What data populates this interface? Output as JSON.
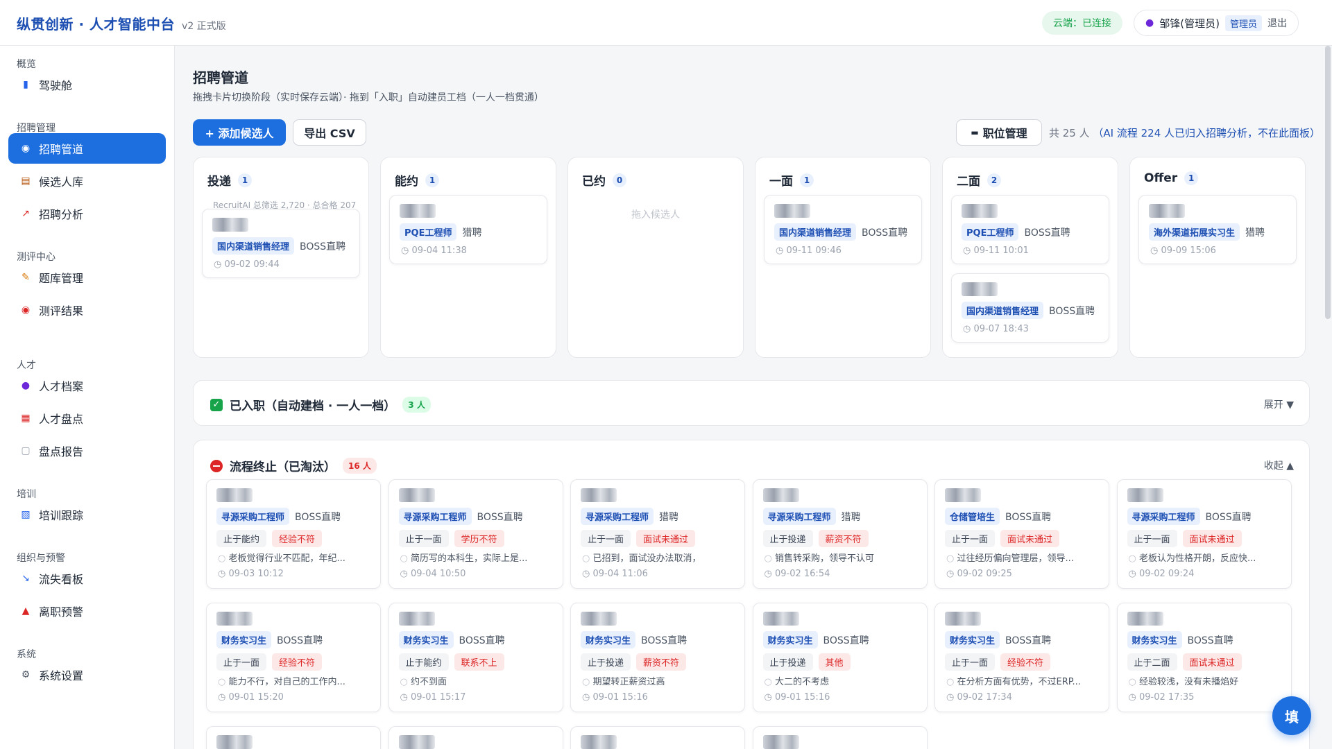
{
  "brand": {
    "title": "纵贯创新 · 人才智能中台",
    "version": "v2 正式版"
  },
  "header": {
    "cloud_status": "云端：已连接",
    "user_name": "邹锋(管理员)",
    "role": "管理员",
    "logout": "退出"
  },
  "sidebar": {
    "sections": [
      {
        "label": "概览",
        "items": [
          {
            "label": "驾驶舱",
            "icon": "dashboard-icon"
          }
        ]
      },
      {
        "label": "招聘管理",
        "items": [
          {
            "label": "招聘管道",
            "icon": "target-icon",
            "active": true
          },
          {
            "label": "候选人库",
            "icon": "clipboard-icon"
          },
          {
            "label": "招聘分析",
            "icon": "trend-chart-icon"
          }
        ]
      },
      {
        "label": "测评中心",
        "items": [
          {
            "label": "题库管理",
            "icon": "edit-doc-icon"
          },
          {
            "label": "测评结果",
            "icon": "target-icon"
          }
        ]
      },
      {
        "label": "人才",
        "items": [
          {
            "label": "人才档案",
            "icon": "person-icon"
          },
          {
            "label": "人才盘点",
            "icon": "calendar-board-icon"
          },
          {
            "label": "盘点报告",
            "icon": "document-icon"
          }
        ]
      },
      {
        "label": "培训",
        "items": [
          {
            "label": "培训跟踪",
            "icon": "books-icon"
          }
        ]
      },
      {
        "label": "组织与预警",
        "items": [
          {
            "label": "流失看板",
            "icon": "down-chart-icon"
          },
          {
            "label": "离职预警",
            "icon": "alert-icon"
          }
        ]
      },
      {
        "label": "系统",
        "items": [
          {
            "label": "系统设置",
            "icon": "gear-icon"
          }
        ]
      }
    ]
  },
  "page": {
    "title": "招聘管道",
    "subtitle": "拖拽卡片切换阶段（实时保存云端）· 拖到「入职」自动建员工档（一人一档贯通）",
    "add_button": "+ 添加候选人",
    "export_button": "导出 CSV",
    "position_button": "职位管理",
    "total": "共 25 人",
    "total_hint": "（AI 流程 224 人已归入招聘分析，不在此面板）"
  },
  "kanban": {
    "columns": [
      {
        "title": "投递",
        "count": "1",
        "note": "RecruitAI 总筛选 2,720 · 总合格 207",
        "cards": [
          {
            "position": "国内渠道销售经理",
            "source": "BOSS直聘",
            "time": "09-02 09:44"
          }
        ]
      },
      {
        "title": "能约",
        "count": "1",
        "cards": [
          {
            "position": "PQE工程师",
            "source": "猎聘",
            "time": "09-04 11:38"
          }
        ]
      },
      {
        "title": "已约",
        "count": "0",
        "empty": "拖入候选人",
        "cards": []
      },
      {
        "title": "一面",
        "count": "1",
        "cards": [
          {
            "position": "国内渠道销售经理",
            "source": "BOSS直聘",
            "time": "09-11 09:46"
          }
        ]
      },
      {
        "title": "二面",
        "count": "2",
        "cards": [
          {
            "position": "PQE工程师",
            "source": "BOSS直聘",
            "time": "09-11 10:01"
          },
          {
            "position": "国内渠道销售经理",
            "source": "BOSS直聘",
            "time": "09-07 18:43"
          }
        ]
      },
      {
        "title": "Offer",
        "count": "1",
        "cards": [
          {
            "position": "海外渠道拓展实习生",
            "source": "猎聘",
            "time": "09-09 15:06"
          }
        ]
      }
    ]
  },
  "hired": {
    "title": "已入职（自动建档 · 一人一档）",
    "count": "3 人",
    "toggle": "展开 ▼"
  },
  "terminated": {
    "title": "流程终止（已淘汰）",
    "count": "16 人",
    "toggle": "收起 ▲",
    "cards": [
      {
        "position": "寻源采购工程师",
        "source": "BOSS直聘",
        "stage": "止于能约",
        "reason": "经验不符",
        "note": "老板觉得行业不匹配，年纪...",
        "time": "09-03 10:12"
      },
      {
        "position": "寻源采购工程师",
        "source": "BOSS直聘",
        "stage": "止于一面",
        "reason": "学历不符",
        "note": "简历写的本科生，实际上是...",
        "time": "09-04 10:50"
      },
      {
        "position": "寻源采购工程师",
        "source": "猎聘",
        "stage": "止于一面",
        "reason": "面试未通过",
        "note": "已招到，面试没办法取消，",
        "time": "09-04 11:06"
      },
      {
        "position": "寻源采购工程师",
        "source": "猎聘",
        "stage": "止于投递",
        "reason": "薪资不符",
        "note": "销售转采购，领导不认可",
        "time": "09-02 16:54"
      },
      {
        "position": "仓储管培生",
        "source": "BOSS直聘",
        "stage": "止于一面",
        "reason": "面试未通过",
        "note": "过往经历偏向管理层，领导...",
        "time": "09-02 09:25"
      },
      {
        "position": "寻源采购工程师",
        "source": "BOSS直聘",
        "stage": "止于一面",
        "reason": "面试未通过",
        "note": "老板认为性格开朗，反应快...",
        "time": "09-02 09:24"
      },
      {
        "position": "财务实习生",
        "source": "BOSS直聘",
        "stage": "止于一面",
        "reason": "经验不符",
        "note": "能力不行，对自己的工作内...",
        "time": "09-01 15:20"
      },
      {
        "position": "财务实习生",
        "source": "BOSS直聘",
        "stage": "止于能约",
        "reason": "联系不上",
        "note": "约不到面",
        "time": "09-01 15:17"
      },
      {
        "position": "财务实习生",
        "source": "BOSS直聘",
        "stage": "止于投递",
        "reason": "薪资不符",
        "note": "期望转正薪资过高",
        "time": "09-01 15:16"
      },
      {
        "position": "财务实习生",
        "source": "BOSS直聘",
        "stage": "止于投递",
        "reason": "其他",
        "note": "大二的不考虑",
        "time": "09-01 15:16"
      },
      {
        "position": "财务实习生",
        "source": "BOSS直聘",
        "stage": "止于一面",
        "reason": "经验不符",
        "note": "在分析方面有优势，不过ERP...",
        "time": "09-02 17:34"
      },
      {
        "position": "财务实习生",
        "source": "BOSS直聘",
        "stage": "止于二面",
        "reason": "面试未通过",
        "note": "经验较浅，没有未播焰好",
        "time": "09-02 17:35"
      }
    ]
  },
  "fab": {
    "label": "填"
  },
  "colors": {
    "primary": "#1d6fe0",
    "brand": "#1d4fb3",
    "success": "#16a34a",
    "danger": "#dc2626"
  }
}
